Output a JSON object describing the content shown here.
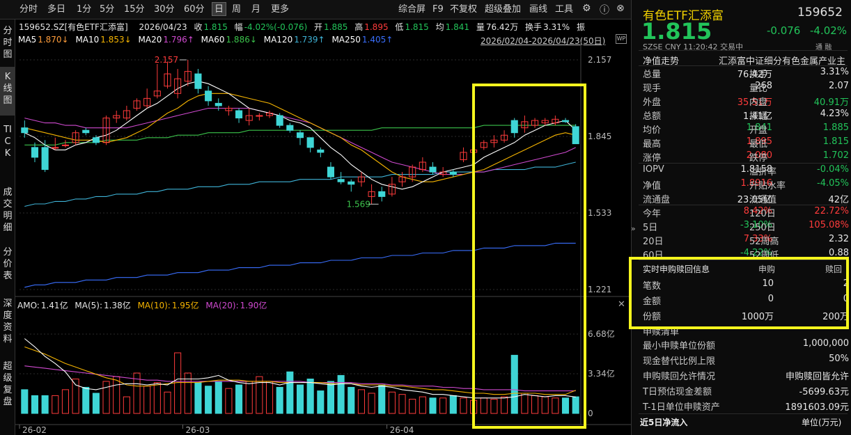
{
  "toolbar": {
    "items": [
      "分时",
      "多日",
      "1分",
      "5分",
      "15分",
      "30分",
      "60分",
      "日",
      "周",
      "月",
      "更多"
    ],
    "active": "日",
    "right": [
      "综合屏",
      "F9",
      "不复权",
      "超级叠加",
      "画线",
      "工具"
    ]
  },
  "leftnav": [
    "分时图",
    "K线图",
    "TICK",
    "成交明细",
    "分价表",
    "深度资料",
    "超级复盘"
  ],
  "header": {
    "code_name": "159652.SZ[有色ETF汇添富]",
    "date": "2026/04/23",
    "close_label": "收",
    "close": "1.815",
    "range_label": "幅",
    "range": "-4.02%(-0.076)",
    "open_label": "开",
    "open": "1.885",
    "high_label": "高",
    "high": "1.895",
    "low_label": "低",
    "low": "1.815",
    "avg_label": "均",
    "avg": "1.841",
    "vol_label": "量",
    "vol": "76.42万",
    "turnover_label": "换手",
    "turnover": "3.31%",
    "amp_label": "振",
    "period": "2026/02/04-2026/04/23(50日)"
  },
  "ma_legend": [
    {
      "label": "MA5",
      "value": "1.870↓",
      "color": "#ffffff"
    },
    {
      "label": "MA10",
      "value": "1.853↓",
      "color": "#f5b400"
    },
    {
      "label": "MA20",
      "value": "1.796↑",
      "color": "#d04ad0"
    },
    {
      "label": "MA60",
      "value": "1.886↓",
      "color": "#3bc34b"
    },
    {
      "label": "MA120",
      "value": "1.739↑",
      "color": "#3fb4d8"
    },
    {
      "label": "MA250",
      "value": "1.405↑",
      "color": "#3a6fff"
    }
  ],
  "vol_legend": {
    "amo_label": "AMO:",
    "amo": "1.41亿",
    "ma5_label": "MA(5):",
    "ma5": "1.38亿",
    "ma10_label": "MA(10):",
    "ma10": "1.95亿",
    "ma20_label": "MA(20):",
    "ma20": "1.90亿"
  },
  "colors": {
    "up": "#ff3b3b",
    "down": "#3fd6d6",
    "ma5": "#ffffff",
    "ma10": "#f5b400",
    "ma20": "#d04ad0",
    "ma60": "#3bc34b",
    "ma120": "#3fb4d8",
    "ma250": "#3a6fff",
    "highlight": "#f5f51e"
  },
  "chart_data": {
    "type": "candlestick",
    "ylim": [
      1.221,
      2.157
    ],
    "y_ticks": [
      "2.157",
      "1.845",
      "1.533",
      "1.221"
    ],
    "vol_ticks": [
      "6.68亿",
      "3.34亿",
      "0"
    ],
    "vol_ylim": [
      0,
      6.68
    ],
    "x_ticks": [
      "26-02",
      "26-03",
      "26-04"
    ],
    "x_tick_index": [
      0,
      16,
      36
    ],
    "max_label": "2.157",
    "min_label": "1.569",
    "max_index": 16,
    "min_index": 34,
    "candles": [
      {
        "o": 1.88,
        "c": 1.86,
        "h": 1.91,
        "l": 1.84
      },
      {
        "o": 1.8,
        "c": 1.76,
        "h": 1.82,
        "l": 1.74
      },
      {
        "o": 1.8,
        "c": 1.71,
        "h": 1.83,
        "l": 1.7
      },
      {
        "o": 1.8,
        "c": 1.8,
        "h": 1.84,
        "l": 1.79
      },
      {
        "o": 1.81,
        "c": 1.81,
        "h": 1.83,
        "l": 1.8
      },
      {
        "o": 1.82,
        "c": 1.86,
        "h": 1.87,
        "l": 1.81
      },
      {
        "o": 1.87,
        "c": 1.86,
        "h": 1.88,
        "l": 1.85
      },
      {
        "o": 1.84,
        "c": 1.82,
        "h": 1.85,
        "l": 1.81
      },
      {
        "o": 1.82,
        "c": 1.92,
        "h": 1.93,
        "l": 1.81
      },
      {
        "o": 1.92,
        "c": 1.93,
        "h": 1.95,
        "l": 1.9
      },
      {
        "o": 1.92,
        "c": 1.95,
        "h": 1.97,
        "l": 1.91
      },
      {
        "o": 1.96,
        "c": 1.99,
        "h": 2.0,
        "l": 1.95
      },
      {
        "o": 1.97,
        "c": 2.0,
        "h": 2.04,
        "l": 1.96
      },
      {
        "o": 2.01,
        "c": 2.03,
        "h": 2.14,
        "l": 2.0
      },
      {
        "o": 2.05,
        "c": 2.1,
        "h": 2.15,
        "l": 2.04
      },
      {
        "o": 2.02,
        "c": 2.08,
        "h": 2.12,
        "l": 2.0
      },
      {
        "o": 2.07,
        "c": 2.11,
        "h": 2.157,
        "l": 2.05
      },
      {
        "o": 2.1,
        "c": 2.04,
        "h": 2.12,
        "l": 2.02
      },
      {
        "o": 2.03,
        "c": 1.99,
        "h": 2.05,
        "l": 1.97
      },
      {
        "o": 1.98,
        "c": 1.97,
        "h": 2.0,
        "l": 1.95
      },
      {
        "o": 1.95,
        "c": 1.96,
        "h": 1.97,
        "l": 1.93
      },
      {
        "o": 1.95,
        "c": 1.92,
        "h": 1.96,
        "l": 1.9
      },
      {
        "o": 1.91,
        "c": 1.93,
        "h": 1.96,
        "l": 1.89
      },
      {
        "o": 1.93,
        "c": 1.93,
        "h": 1.94,
        "l": 1.91
      },
      {
        "o": 1.93,
        "c": 1.94,
        "h": 1.95,
        "l": 1.92
      },
      {
        "o": 1.93,
        "c": 1.89,
        "h": 1.94,
        "l": 1.88
      },
      {
        "o": 1.89,
        "c": 1.87,
        "h": 1.9,
        "l": 1.86
      },
      {
        "o": 1.86,
        "c": 1.84,
        "h": 1.87,
        "l": 1.81
      },
      {
        "o": 1.84,
        "c": 1.8,
        "h": 1.84,
        "l": 1.78
      },
      {
        "o": 1.79,
        "c": 1.78,
        "h": 1.8,
        "l": 1.76
      },
      {
        "o": 1.72,
        "c": 1.68,
        "h": 1.74,
        "l": 1.67
      },
      {
        "o": 1.67,
        "c": 1.66,
        "h": 1.7,
        "l": 1.65
      },
      {
        "o": 1.66,
        "c": 1.65,
        "h": 1.67,
        "l": 1.62
      },
      {
        "o": 1.66,
        "c": 1.68,
        "h": 1.7,
        "l": 1.64
      },
      {
        "o": 1.6,
        "c": 1.62,
        "h": 1.65,
        "l": 1.569
      },
      {
        "o": 1.62,
        "c": 1.6,
        "h": 1.64,
        "l": 1.58
      },
      {
        "o": 1.61,
        "c": 1.65,
        "h": 1.68,
        "l": 1.6
      },
      {
        "o": 1.66,
        "c": 1.68,
        "h": 1.7,
        "l": 1.64
      },
      {
        "o": 1.68,
        "c": 1.72,
        "h": 1.73,
        "l": 1.66
      },
      {
        "o": 1.71,
        "c": 1.74,
        "h": 1.76,
        "l": 1.7
      },
      {
        "o": 1.72,
        "c": 1.7,
        "h": 1.74,
        "l": 1.69
      },
      {
        "o": 1.69,
        "c": 1.7,
        "h": 1.72,
        "l": 1.68
      },
      {
        "o": 1.7,
        "c": 1.69,
        "h": 1.71,
        "l": 1.68
      },
      {
        "o": 1.75,
        "c": 1.78,
        "h": 1.8,
        "l": 1.74
      },
      {
        "o": 1.78,
        "c": 1.79,
        "h": 1.81,
        "l": 1.76
      },
      {
        "o": 1.8,
        "c": 1.82,
        "h": 1.83,
        "l": 1.79
      },
      {
        "o": 1.82,
        "c": 1.83,
        "h": 1.85,
        "l": 1.8
      },
      {
        "o": 1.83,
        "c": 1.85,
        "h": 1.87,
        "l": 1.82
      },
      {
        "o": 1.91,
        "c": 1.86,
        "h": 1.92,
        "l": 1.84
      },
      {
        "o": 1.88,
        "c": 1.905,
        "h": 1.93,
        "l": 1.86
      },
      {
        "o": 1.89,
        "c": 1.91,
        "h": 1.92,
        "l": 1.88
      },
      {
        "o": 1.9,
        "c": 1.91,
        "h": 1.92,
        "l": 1.89
      },
      {
        "o": 1.9,
        "c": 1.915,
        "h": 1.93,
        "l": 1.89
      },
      {
        "o": 1.91,
        "c": 1.905,
        "h": 1.92,
        "l": 1.9
      },
      {
        "o": 1.885,
        "c": 1.815,
        "h": 1.895,
        "l": 1.815
      }
    ],
    "volumes": [
      2.0,
      1.5,
      1.5,
      1.5,
      2.0,
      2.9,
      2.2,
      1.7,
      2.7,
      3.1,
      1.4,
      3.4,
      2.3,
      2.6,
      1.8,
      5.1,
      3.4,
      2.6,
      2.3,
      2.7,
      2.1,
      2.4,
      2.7,
      3.1,
      2.7,
      2.2,
      3.5,
      2.4,
      2.9,
      1.9,
      2.7,
      3.2,
      2.2,
      2.0,
      1.7,
      2.4,
      1.8,
      1.6,
      1.2,
      1.4,
      1.3,
      1.3,
      1.5,
      1.3,
      1.1,
      1.3,
      1.2,
      1.4,
      4.9,
      1.7,
      1.5,
      1.4,
      1.3,
      1.3,
      1.4
    ],
    "ma_series": {
      "ma5": [
        1.86,
        1.84,
        1.81,
        1.79,
        1.79,
        1.81,
        1.82,
        1.84,
        1.85,
        1.87,
        1.9,
        1.93,
        1.96,
        1.98,
        2.01,
        2.04,
        2.06,
        2.07,
        2.06,
        2.04,
        2.02,
        1.99,
        1.96,
        1.95,
        1.94,
        1.93,
        1.91,
        1.9,
        1.88,
        1.84,
        1.8,
        1.77,
        1.73,
        1.7,
        1.67,
        1.65,
        1.64,
        1.63,
        1.64,
        1.66,
        1.68,
        1.7,
        1.71,
        1.72,
        1.73,
        1.76,
        1.78,
        1.8,
        1.82,
        1.85,
        1.87,
        1.89,
        1.9,
        1.91,
        1.87
      ],
      "ma10": [
        1.88,
        1.87,
        1.86,
        1.85,
        1.84,
        1.83,
        1.83,
        1.83,
        1.82,
        1.83,
        1.84,
        1.86,
        1.88,
        1.91,
        1.94,
        1.96,
        1.99,
        2.01,
        2.02,
        2.02,
        2.02,
        2.01,
        2.0,
        1.99,
        1.98,
        1.96,
        1.94,
        1.92,
        1.9,
        1.88,
        1.86,
        1.84,
        1.81,
        1.79,
        1.76,
        1.73,
        1.7,
        1.68,
        1.67,
        1.66,
        1.66,
        1.67,
        1.68,
        1.69,
        1.7,
        1.71,
        1.73,
        1.75,
        1.77,
        1.79,
        1.81,
        1.83,
        1.85,
        1.86,
        1.85
      ],
      "ma20": [
        1.92,
        1.91,
        1.9,
        1.9,
        1.89,
        1.89,
        1.88,
        1.88,
        1.88,
        1.88,
        1.88,
        1.89,
        1.9,
        1.91,
        1.92,
        1.93,
        1.94,
        1.95,
        1.96,
        1.96,
        1.96,
        1.96,
        1.96,
        1.95,
        1.94,
        1.93,
        1.92,
        1.91,
        1.9,
        1.88,
        1.86,
        1.84,
        1.82,
        1.8,
        1.78,
        1.76,
        1.74,
        1.73,
        1.72,
        1.71,
        1.7,
        1.69,
        1.69,
        1.69,
        1.7,
        1.7,
        1.71,
        1.72,
        1.73,
        1.74,
        1.75,
        1.76,
        1.77,
        1.78,
        1.8
      ],
      "ma60": [
        1.81,
        1.81,
        1.81,
        1.81,
        1.82,
        1.82,
        1.82,
        1.82,
        1.83,
        1.83,
        1.83,
        1.83,
        1.84,
        1.84,
        1.84,
        1.85,
        1.85,
        1.85,
        1.86,
        1.86,
        1.86,
        1.86,
        1.87,
        1.87,
        1.87,
        1.87,
        1.87,
        1.87,
        1.87,
        1.87,
        1.87,
        1.87,
        1.87,
        1.87,
        1.87,
        1.88,
        1.88,
        1.88,
        1.88,
        1.88,
        1.88,
        1.88,
        1.88,
        1.88,
        1.88,
        1.89,
        1.89,
        1.89,
        1.89,
        1.89,
        1.89,
        1.89,
        1.89,
        1.89,
        1.89
      ],
      "ma120": [
        1.56,
        1.57,
        1.57,
        1.58,
        1.58,
        1.59,
        1.59,
        1.6,
        1.6,
        1.61,
        1.61,
        1.61,
        1.62,
        1.62,
        1.63,
        1.63,
        1.63,
        1.64,
        1.64,
        1.64,
        1.65,
        1.65,
        1.65,
        1.66,
        1.66,
        1.66,
        1.66,
        1.67,
        1.67,
        1.67,
        1.67,
        1.68,
        1.68,
        1.68,
        1.68,
        1.68,
        1.69,
        1.69,
        1.69,
        1.69,
        1.69,
        1.7,
        1.7,
        1.7,
        1.7,
        1.7,
        1.71,
        1.71,
        1.71,
        1.71,
        1.72,
        1.72,
        1.72,
        1.73,
        1.74
      ],
      "ma250": [
        1.23,
        1.24,
        1.24,
        1.25,
        1.25,
        1.25,
        1.26,
        1.26,
        1.26,
        1.27,
        1.27,
        1.27,
        1.28,
        1.28,
        1.28,
        1.29,
        1.29,
        1.29,
        1.3,
        1.3,
        1.3,
        1.31,
        1.31,
        1.31,
        1.32,
        1.32,
        1.32,
        1.33,
        1.33,
        1.33,
        1.34,
        1.34,
        1.34,
        1.35,
        1.35,
        1.35,
        1.36,
        1.36,
        1.36,
        1.37,
        1.37,
        1.37,
        1.38,
        1.38,
        1.38,
        1.39,
        1.39,
        1.39,
        1.4,
        1.4,
        1.4,
        1.4,
        1.41,
        1.41,
        1.41
      ]
    },
    "vol_ma": {
      "ma5": [
        6.3,
        5.6,
        4.8,
        4.2,
        3.5,
        2.4,
        2.1,
        2.0,
        2.2,
        2.4,
        2.5,
        2.5,
        2.4,
        2.5,
        2.4,
        2.9,
        2.9,
        2.9,
        3.0,
        3.2,
        2.8,
        2.6,
        2.5,
        2.6,
        2.6,
        2.4,
        2.6,
        2.6,
        2.6,
        2.5,
        2.4,
        2.5,
        2.5,
        2.3,
        2.2,
        2.3,
        2.2,
        2.0,
        1.9,
        1.8,
        1.6,
        1.6,
        1.5,
        1.4,
        1.3,
        1.3,
        1.3,
        1.3,
        1.4,
        1.6,
        1.5,
        1.4,
        1.5,
        1.5,
        1.38
      ],
      "ma10": [
        5.6,
        5.3,
        5.0,
        4.6,
        4.2,
        3.9,
        3.6,
        3.3,
        3.0,
        2.8,
        2.4,
        2.3,
        2.3,
        2.4,
        2.5,
        2.6,
        2.6,
        2.6,
        2.7,
        2.8,
        2.8,
        2.8,
        2.7,
        2.7,
        2.7,
        2.6,
        2.6,
        2.6,
        2.6,
        2.6,
        2.5,
        2.5,
        2.5,
        2.4,
        2.4,
        2.4,
        2.3,
        2.3,
        2.2,
        2.1,
        2.0,
        2.0,
        1.9,
        1.8,
        1.7,
        1.7,
        1.6,
        1.6,
        1.7,
        1.7,
        1.7,
        1.6,
        1.6,
        1.6,
        1.95
      ],
      "ma20": [
        4.0,
        3.9,
        3.8,
        3.7,
        3.6,
        3.5,
        3.4,
        3.3,
        3.2,
        3.1,
        3.0,
        2.9,
        2.8,
        2.8,
        2.7,
        2.7,
        2.7,
        2.7,
        2.7,
        2.7,
        2.7,
        2.7,
        2.7,
        2.7,
        2.7,
        2.7,
        2.7,
        2.7,
        2.6,
        2.6,
        2.6,
        2.6,
        2.6,
        2.5,
        2.5,
        2.5,
        2.4,
        2.4,
        2.3,
        2.3,
        2.3,
        2.2,
        2.2,
        2.1,
        2.1,
        2.0,
        2.0,
        2.0,
        2.0,
        1.9,
        1.9,
        1.9,
        1.9,
        1.9,
        1.9
      ]
    }
  },
  "rpanel": {
    "name": "有色ETF汇添富",
    "code": "159652",
    "price": "1.815",
    "change": "-0.076",
    "change_pct": "-4.02%",
    "exch": "SZSE",
    "currency": "CNY",
    "time": "11:20:42",
    "status": "交易中",
    "nav_label": "净值走势",
    "nav_desc": "汇添富中证细分有色金属产业主",
    "rows": [
      {
        "l": "总量",
        "v": "76.42万",
        "vc": "white",
        "l2": "换手",
        "v2": "3.31%",
        "v2c": "white"
      },
      {
        "l": "现手",
        "v": "268",
        "vc": "white",
        "l2": "量比",
        "v2": "2.07",
        "v2c": "white"
      },
      {
        "l": "外盘",
        "v": "35.51万",
        "vc": "red",
        "l2": "内盘",
        "v2": "40.91万",
        "v2c": "green"
      },
      {
        "l": "总额",
        "v": "1.41亿",
        "vc": "white",
        "l2": "振幅",
        "v2": "4.23%",
        "v2c": "white"
      },
      {
        "l": "均价",
        "v": "1.841",
        "vc": "green",
        "l2": "开盘",
        "v2": "1.885",
        "v2c": "green"
      },
      {
        "l": "最高",
        "v": "1.895",
        "vc": "red",
        "l2": "最低",
        "v2": "1.815",
        "v2c": "green"
      },
      {
        "l": "涨停",
        "v": "2.080",
        "vc": "red",
        "l2": "跌停",
        "v2": "1.702",
        "v2c": "green"
      },
      {
        "l": "IOPV",
        "v": "1.8158",
        "vc": "white",
        "l2": "溢折率",
        "v2": "-0.04%",
        "v2c": "green"
      },
      {
        "l": "净值",
        "v": "1.8916",
        "vc": "red",
        "l2": "升贴水率",
        "v2": "-4.05%",
        "v2c": "green"
      },
      {
        "l": "流通盘",
        "v": "23.05亿",
        "vc": "white",
        "l2": "流通值",
        "v2": "42亿",
        "v2c": "white"
      },
      {
        "l": "今年",
        "v": "8.42%",
        "vc": "red",
        "l2": "120日",
        "v2": "22.72%",
        "v2c": "red"
      },
      {
        "l": "5日",
        "v": "-3.10%",
        "vc": "green",
        "l2": "250日",
        "v2": "105.08%",
        "v2c": "red"
      },
      {
        "l": "20日",
        "v": "7.33%",
        "vc": "red",
        "l2": "52周高",
        "v2": "2.32",
        "v2c": "white"
      },
      {
        "l": "60日",
        "v": "-4.22%",
        "vc": "green",
        "l2": "52周低",
        "v2": "0.88",
        "v2c": "white"
      }
    ],
    "sub": {
      "title": "实时申购赎回信息",
      "col1": "申购",
      "col2": "赎回",
      "rows": [
        {
          "l": "笔数",
          "a": "10",
          "b": "2"
        },
        {
          "l": "金额",
          "a": "0",
          "b": "0"
        },
        {
          "l": "份额",
          "a": "1000万",
          "b": "200万"
        }
      ]
    },
    "list_title": "申赎清单",
    "list": [
      {
        "l": "最小申赎单位份额",
        "v": "1,000,000"
      },
      {
        "l": "现金替代比例上限",
        "v": "50%"
      },
      {
        "l": "申购赎回允许情况",
        "v": "申购赎回皆允许"
      },
      {
        "l": "T日预估现金差额",
        "v": "-5699.63元"
      },
      {
        "l": "T-1日单位申赎资产",
        "v": "1891603.09元"
      }
    ],
    "footer_left": "近5日净流入",
    "footer_right": "单位(万元)",
    "tong": "通",
    "rong": "融"
  }
}
